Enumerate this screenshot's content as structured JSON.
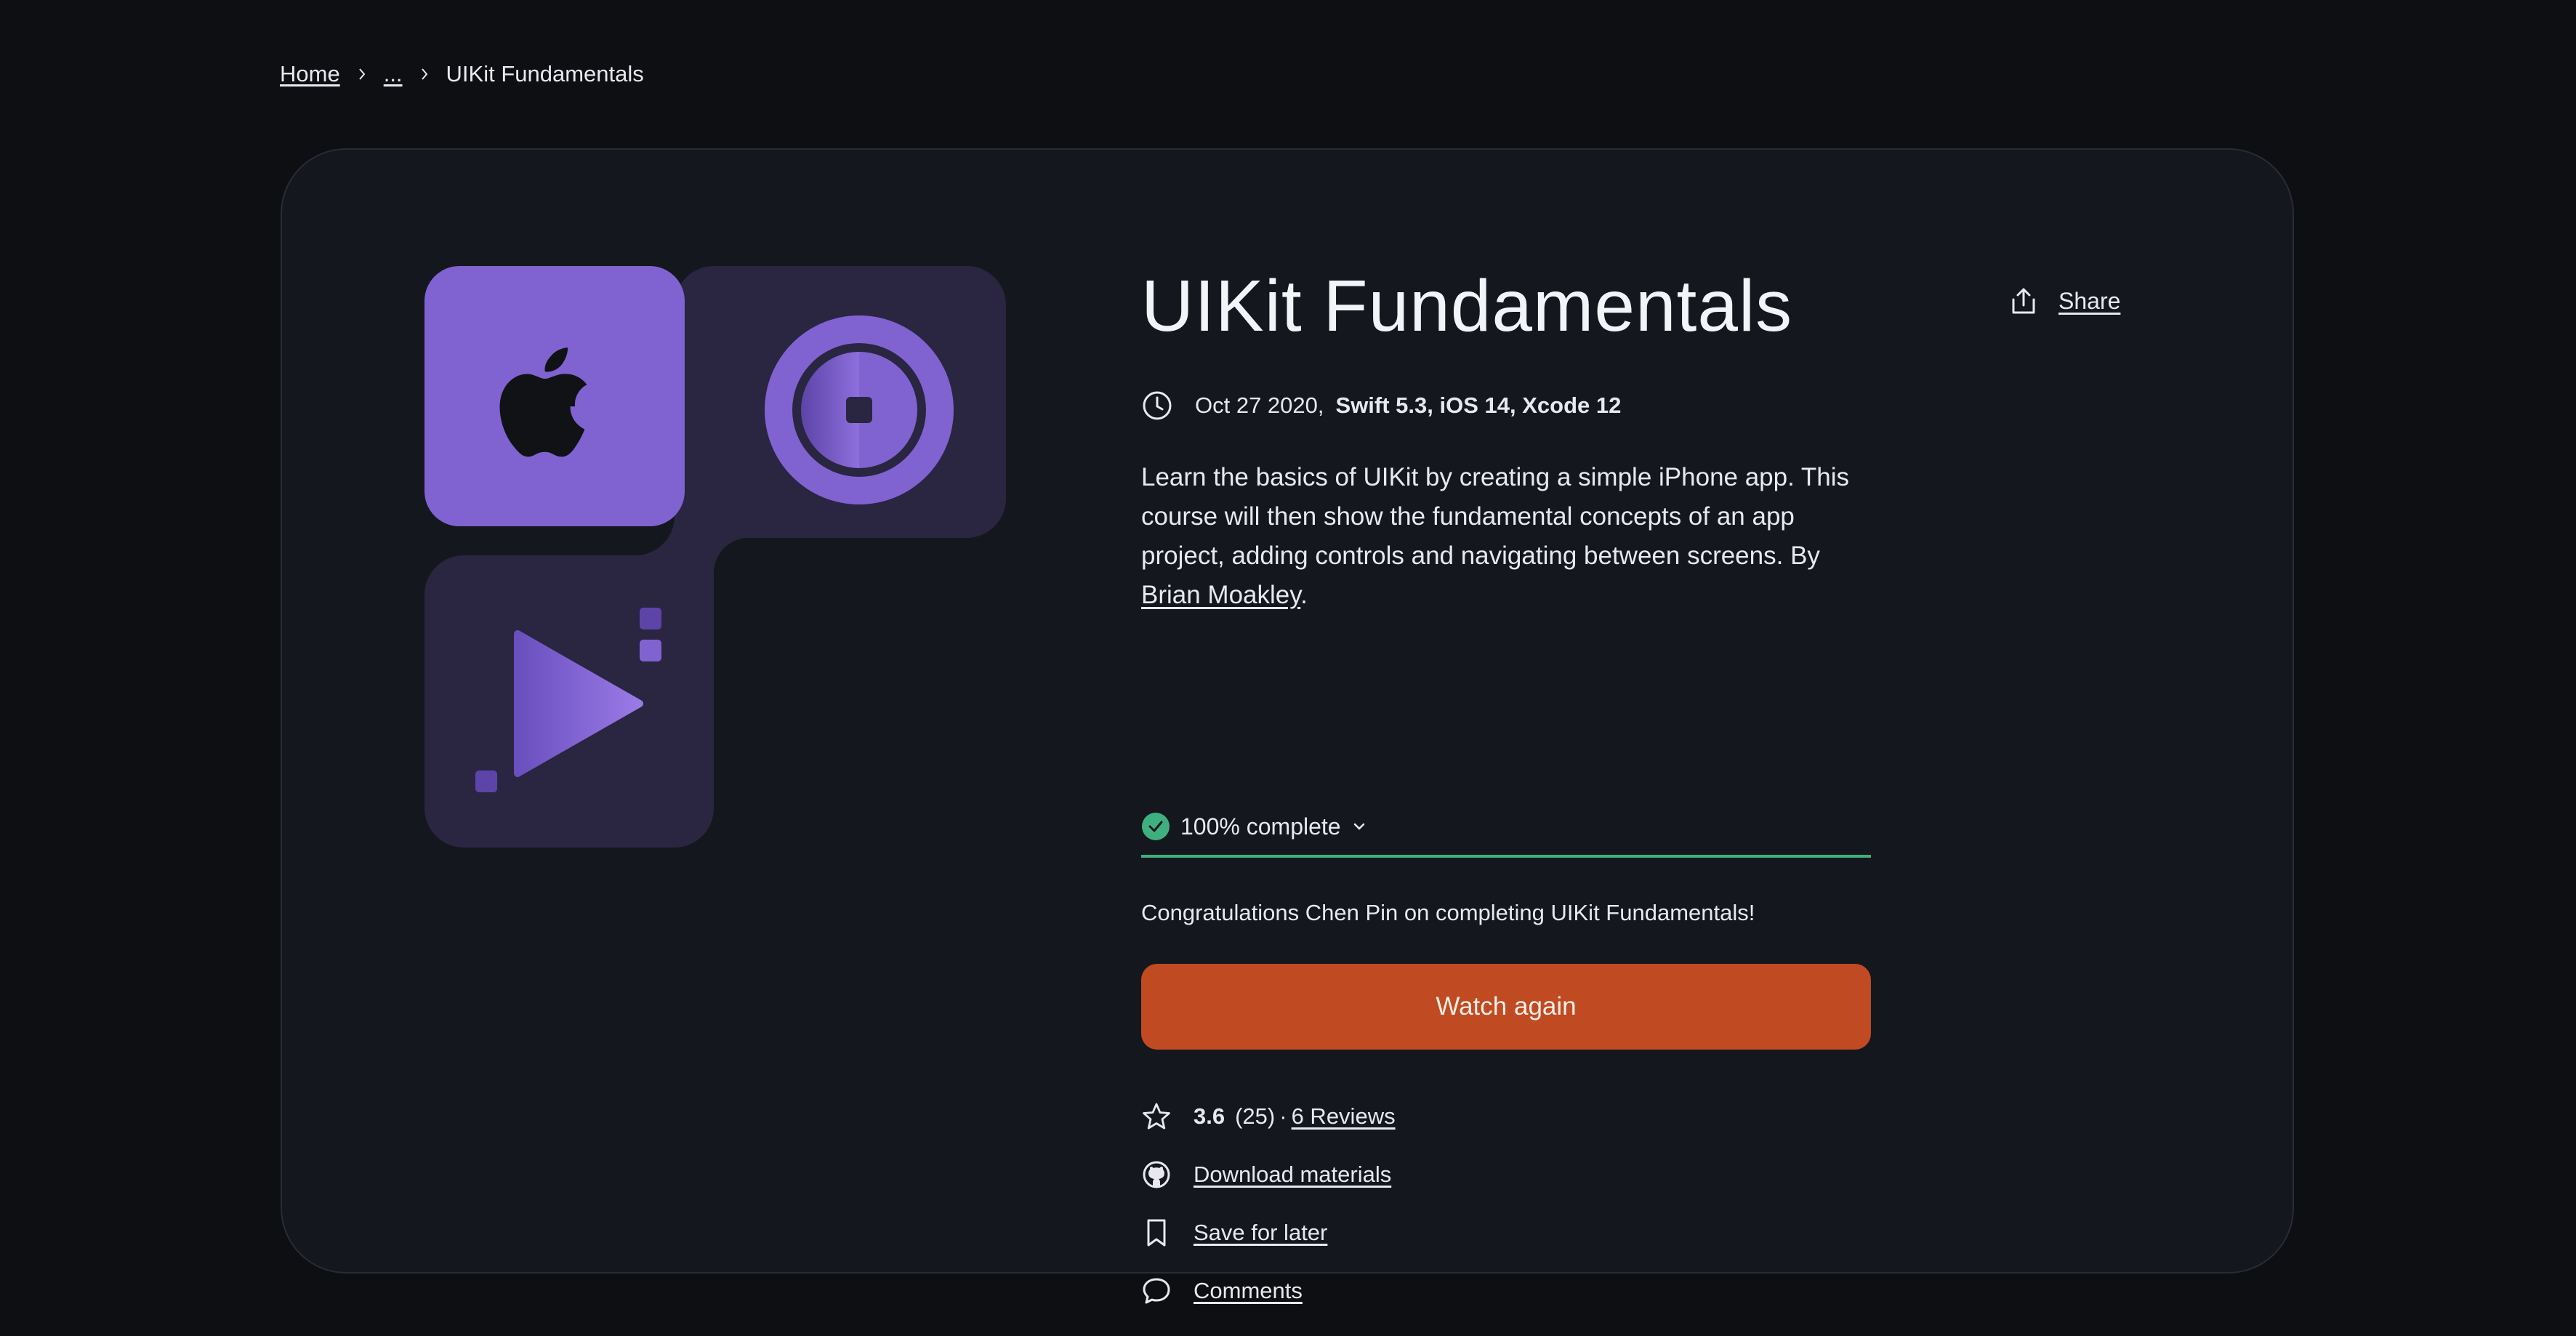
{
  "breadcrumb": {
    "home": "Home",
    "ellipsis": "...",
    "current": "UIKit Fundamentals"
  },
  "course": {
    "title": "UIKit Fundamentals",
    "share_label": "Share",
    "date": "Oct 27 2020,",
    "tech": "Swift 5.3, iOS 14, Xcode 12",
    "description_text": "Learn the basics of UIKit by creating a simple iPhone app. This course will then show the fundamental concepts of an app project, adding controls and navigating between screens. By ",
    "author": "Brian Moakley",
    "description_end": "."
  },
  "progress": {
    "label": "100% complete",
    "fraction": 1.0
  },
  "congrats": "Congratulations Chen Pin on completing UIKit Fundamentals!",
  "watch_button": "Watch again",
  "rating": {
    "score": "3.6",
    "count": "(25)",
    "separator": "·",
    "reviews": "6 Reviews"
  },
  "actions": {
    "download": "Download materials",
    "save": "Save for later",
    "comments": "Comments"
  },
  "colors": {
    "background": "#0e0f13",
    "card": "#15171e",
    "accent_button": "#c04a21",
    "progress": "#3eb07f",
    "art_purple": "#8063d1",
    "art_dark": "#2a2540"
  },
  "icons": {
    "clock": "clock-icon",
    "share": "share-icon",
    "check": "check-circle-icon",
    "star": "star-icon",
    "github": "github-icon",
    "bookmark": "bookmark-icon",
    "comment": "comment-icon"
  }
}
